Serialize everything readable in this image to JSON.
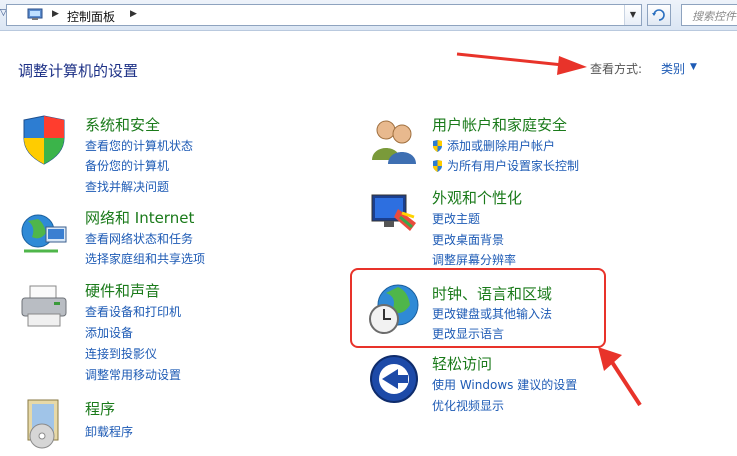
{
  "address_bar": {
    "breadcrumb": "控制面板",
    "search_placeholder": "搜索控件"
  },
  "header": {
    "title": "调整计算机的设置",
    "view_by_label": "查看方式:",
    "view_by_value": "类别"
  },
  "categories": [
    {
      "title": "系统和安全",
      "icon": "system-security-icon",
      "links": [
        "查看您的计算机状态",
        "备份您的计算机",
        "查找并解决问题"
      ]
    },
    {
      "title": "网络和 Internet",
      "icon": "network-icon",
      "links": [
        "查看网络状态和任务",
        "选择家庭组和共享选项"
      ]
    },
    {
      "title": "硬件和声音",
      "icon": "printer-icon",
      "links": [
        "查看设备和打印机",
        "添加设备",
        "连接到投影仪",
        "调整常用移动设置"
      ]
    },
    {
      "title": "程序",
      "icon": "programs-icon",
      "links": [
        "卸载程序"
      ]
    },
    {
      "title": "用户帐户和家庭安全",
      "icon": "users-icon",
      "links": [
        "添加或删除用户帐户",
        "为所有用户设置家长控制"
      ]
    },
    {
      "title": "外观和个性化",
      "icon": "appearance-icon",
      "links": [
        "更改主题",
        "更改桌面背景",
        "调整屏幕分辨率"
      ]
    },
    {
      "title": "时钟、语言和区域",
      "icon": "clock-globe-icon",
      "links": [
        "更改键盘或其他输入法",
        "更改显示语言"
      ]
    },
    {
      "title": "轻松访问",
      "icon": "ease-of-access-icon",
      "links": [
        "使用 Windows 建议的设置",
        "优化视频显示"
      ]
    }
  ],
  "colors": {
    "title_green": "#1a7a1a",
    "link_blue": "#1e5bb5",
    "annotation_red": "#e8332a"
  }
}
